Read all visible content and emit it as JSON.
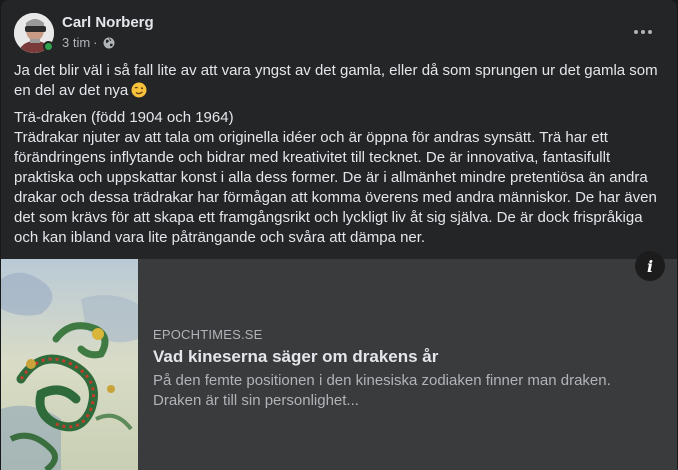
{
  "post": {
    "author": "Carl Norberg",
    "time": "3 tim",
    "separator": "·",
    "privacy_icon": "globe-icon",
    "more_icon": "more-options-icon",
    "text_paragraph_1": "Ja det blir väl i så fall lite av att vara yngst av det gamla, eller då som sprungen ur det gamla som en del av det nya",
    "emoji": "winking-face",
    "text_line_heading": "Trä-draken (född 1904 och 1964)",
    "text_paragraph_2": "Trädrakar njuter av att tala om originella idéer och är öppna för andras synsätt. Trä har ett förändringens inflytande och bidrar med kreativitet till tecknet. De är innovativa, fantasifullt praktiska och uppskattar konst i alla dess former. De är i allmänhet mindre pretentiösa än andra drakar och dessa  trädrakar har förmågan att komma överens med andra människor. De har även det som krävs för att skapa ett framgångsrikt och lyckligt liv åt sig själva. De är dock frispråkiga och kan ibland vara lite påträngande och svåra att dämpa ner."
  },
  "link": {
    "domain": "EPOCHTIMES.SE",
    "title": "Vad kineserna säger om drakens år",
    "description": "På den femte positionen i den kinesiska zodiaken finner man draken. Draken är till sin personlighet...",
    "info_label": "i",
    "thumbnail": "dragon-painting-image"
  },
  "colors": {
    "background": "#242526",
    "card": "#3a3b3c",
    "text": "#e4e6eb",
    "secondary": "#b0b3b8",
    "online": "#31a24c"
  }
}
